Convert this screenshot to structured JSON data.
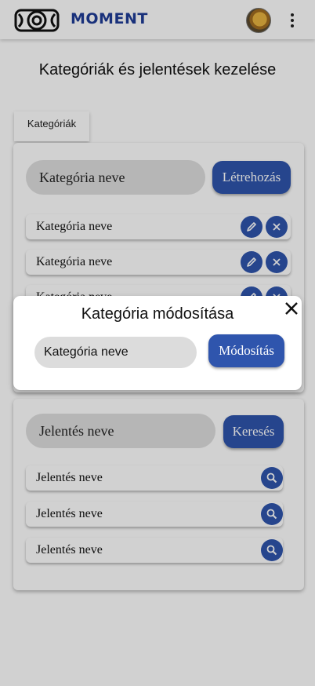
{
  "header": {
    "brand": "MOMENT"
  },
  "page": {
    "title": "Kategóriák és jelentések kezelése"
  },
  "tabs": [
    {
      "label": "Kategóriák"
    }
  ],
  "categories": {
    "input_value": "Kategória neve",
    "create_label": "Létrehozás",
    "rows": [
      "Kategória neve",
      "Kategória neve",
      "Kategória neve"
    ]
  },
  "reports": {
    "input_value": "Jelentés neve",
    "search_label": "Keresés",
    "rows": [
      "Jelentés neve",
      "Jelentés neve",
      "Jelentés neve"
    ]
  },
  "modal": {
    "title": "Kategória módosítása",
    "input_value": "Kategória neve",
    "submit_label": "Módosítás"
  },
  "icons": {
    "logo": "film-reel-logo-icon",
    "menu": "more-vertical-icon",
    "edit": "pencil-icon",
    "delete": "close-icon",
    "search": "magnifier-icon",
    "modal_close": "close-icon"
  },
  "colors": {
    "accent": "#2f55ad",
    "brand": "#1f3c97"
  }
}
